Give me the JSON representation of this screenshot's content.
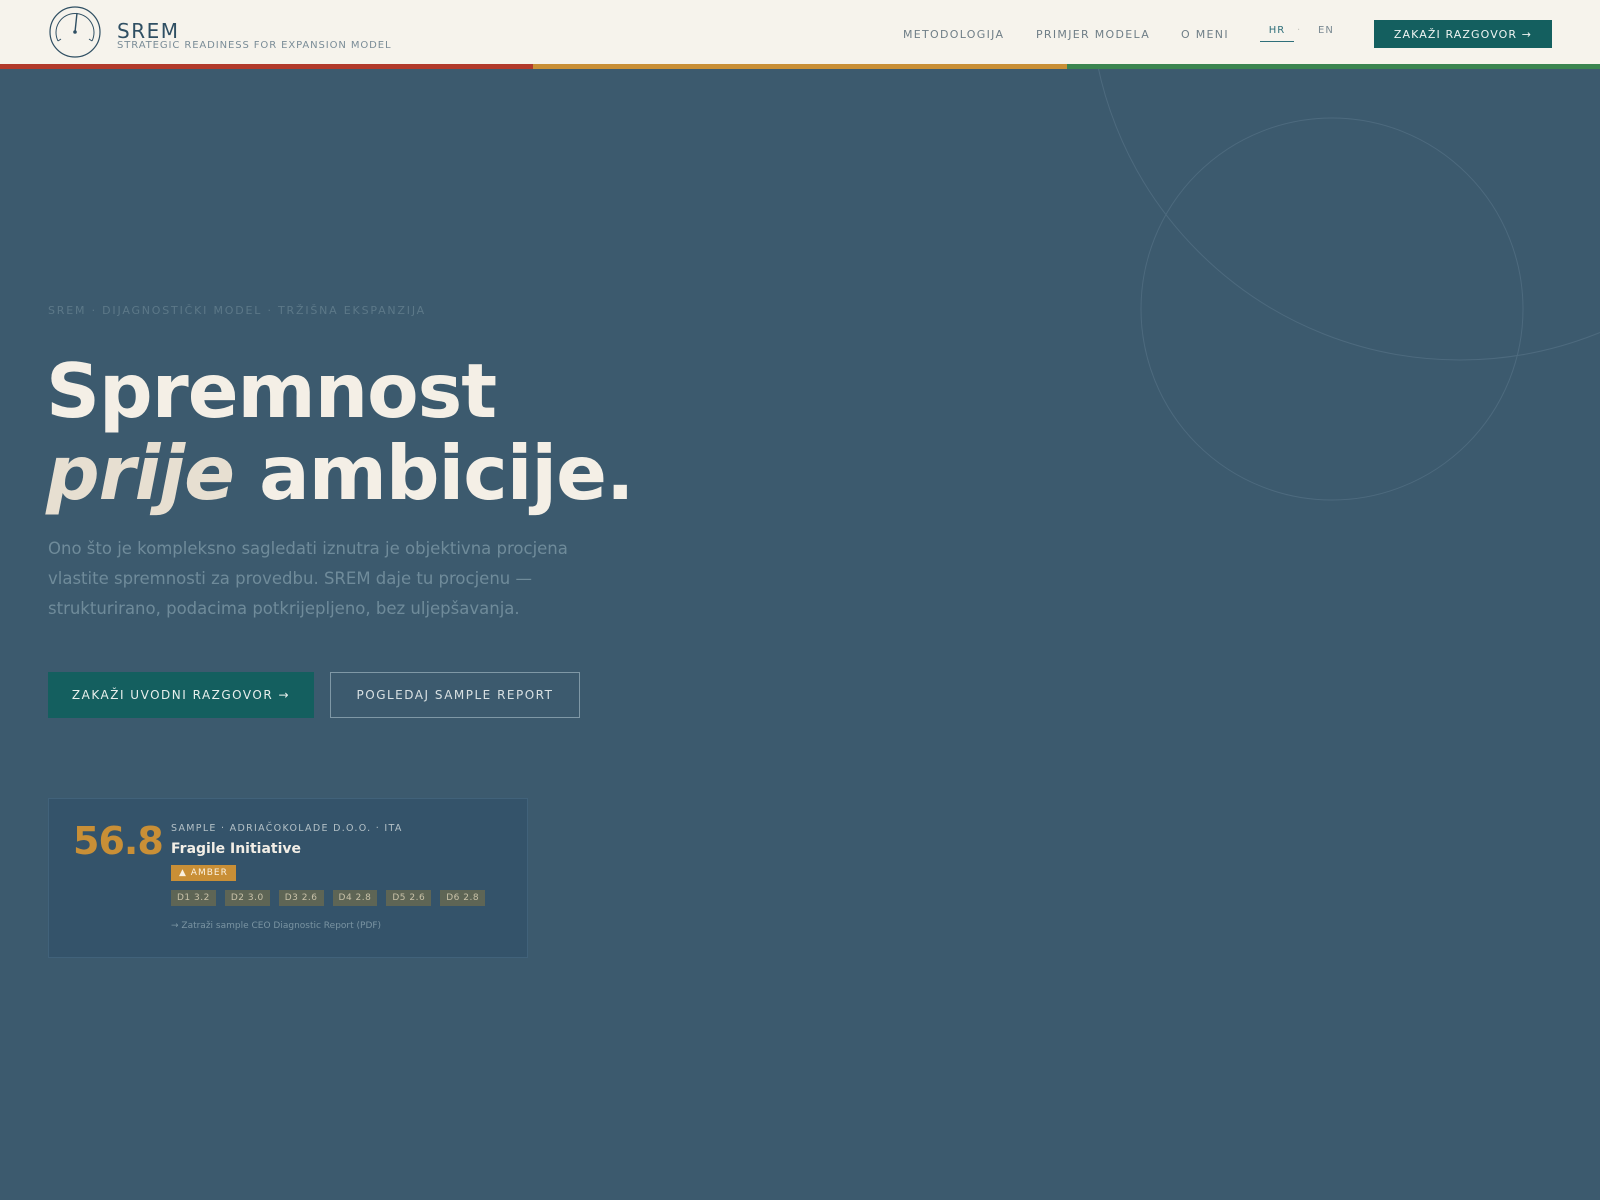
{
  "header": {
    "brand_name": "SREM",
    "brand_tagline": "STRATEGIC READINESS FOR EXPANSION MODEL",
    "nav": [
      {
        "label": "METODOLOGIJA"
      },
      {
        "label": "PRIMJER MODELA"
      },
      {
        "label": "O MENI"
      }
    ],
    "languages": [
      {
        "code": "HR",
        "active": true
      },
      {
        "code": "EN",
        "active": false
      }
    ],
    "cta_label": "ZAKAŽI RAZGOVOR →"
  },
  "accent_colors": [
    "#b23a2b",
    "#c98f36",
    "#3b8550"
  ],
  "hero": {
    "eyebrow": "SREM · DIJAGNOSTIČKI MODEL · TRŽIŠNA EKSPANZIJA",
    "headline_line1": "Spremnost",
    "headline_emphasis": "prije",
    "headline_rest": "ambicije.",
    "lead": "Ono što je kompleksno sagledati iznutra je objektivna procjena vlastite spremnosti za provedbu. SREM daje tu procjenu — strukturirano, podacima potkrijepljeno, bez uljepšavanja.",
    "primary_cta": "ZAKAŽI UVODNI RAZGOVOR →",
    "secondary_cta": "POGLEDAJ SAMPLE REPORT"
  },
  "sample_card": {
    "score": "56.8",
    "meta": "SAMPLE · ADRIAČOKOLADE D.O.O. · ITA",
    "title": "Fragile Initiative",
    "badge": "▲ AMBER",
    "dimensions": [
      "D1 3.2",
      "D2 3.0",
      "D3 2.6",
      "D4 2.8",
      "D5 2.6",
      "D6 2.8"
    ],
    "link": "→ Zatraži sample CEO Diagnostic Report (PDF)"
  },
  "colors": {
    "background": "#3c5a6e",
    "header_bg": "#f6f3ec",
    "teal": "#145f5f",
    "amber": "#c98f36"
  }
}
